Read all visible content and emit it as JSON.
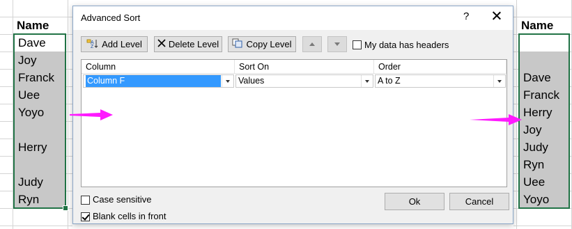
{
  "left_sheet": {
    "header": "Name",
    "rows": [
      "Dave",
      "Joy",
      "Franck",
      "Uee",
      "Yoyo",
      "",
      "Herry",
      "",
      "Judy",
      "Ryn"
    ]
  },
  "right_sheet": {
    "header": "Name",
    "rows": [
      "",
      "",
      "Dave",
      "Franck",
      "Herry",
      "Joy",
      "Judy",
      "Ryn",
      "Uee",
      "Yoyo"
    ]
  },
  "dialog": {
    "title": "Advanced Sort",
    "help": "?",
    "toolbar": {
      "add_level": "Add Level",
      "delete_level": "Delete Level",
      "copy_level": "Copy Level",
      "my_data_has_headers": "My data has headers"
    },
    "columns": {
      "column": "Column",
      "sort_on": "Sort On",
      "order": "Order"
    },
    "row": {
      "column_value": "Column F",
      "sort_on_value": "Values",
      "order_value": "A to Z"
    },
    "options": {
      "case_sensitive": "Case sensitive",
      "blank_cells_in_front": "Blank cells in front"
    },
    "ok": "Ok",
    "cancel": "Cancel"
  },
  "colors": {
    "arrow": "#ff1aff",
    "selection_border": "#217346",
    "blank_fill": "#c8c8c8",
    "highlight": "#3399ff"
  }
}
